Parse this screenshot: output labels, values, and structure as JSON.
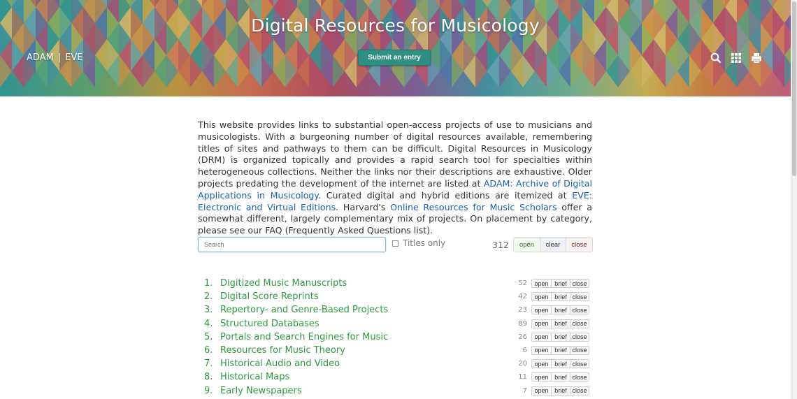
{
  "header": {
    "title": "Digital Resources for Musicology",
    "nav": [
      {
        "label": "ADAM"
      },
      {
        "label": "EVE"
      }
    ],
    "nav_separator": "|",
    "submit_label": "Submit an entry",
    "icons": [
      "search-icon",
      "grid-icon",
      "print-icon"
    ]
  },
  "intro": {
    "p1": "This website provides links to substantial open-access projects of use to musicians and musicologists. With a burgeoning number of digital resources available, remembering titles of sites and pathways to them can be difficult. Digital Resources in Musicology (DRM) is organized topically and provides a rapid search tool for specialties within heterogeneous collections. Neither the links nor their descriptions are exhaustive. Older projects predating the development of the internet are listed at ",
    "link_adam": "ADAM: Archive of Digital Applications in Musicology",
    "p2": ". Curated digital and hybrid editions are itemized at ",
    "link_eve": "EVE: Electronic and Virtual Editions",
    "p3": ". Harvard's ",
    "link_harvard": "Online Resources for Music Scholars",
    "p4": " offer a somewhat different, largely complementary mix of projects. On placement by category, please see our FAQ (Frequently Asked Questions list)."
  },
  "search": {
    "placeholder": "Search",
    "value": "",
    "titles_only_label": "Titles only",
    "total": "312",
    "open_label": "open",
    "clear_label": "clear",
    "close_label": "close"
  },
  "row_buttons": {
    "open": "open",
    "brief": "brief",
    "close": "close"
  },
  "categories": [
    {
      "num": "1.",
      "title": "Digitized Music Manuscripts",
      "count": "52"
    },
    {
      "num": "2.",
      "title": "Digital Score Reprints",
      "count": "42"
    },
    {
      "num": "3.",
      "title": "Repertory- and Genre-Based Projects",
      "count": "23"
    },
    {
      "num": "4.",
      "title": "Structured Databases",
      "count": "89"
    },
    {
      "num": "5.",
      "title": "Portals and Search Engines for Music",
      "count": "26"
    },
    {
      "num": "6.",
      "title": "Resources for Music Theory",
      "count": "6"
    },
    {
      "num": "7.",
      "title": "Historical Audio and Video",
      "count": "20"
    },
    {
      "num": "8.",
      "title": "Historical Maps",
      "count": "11"
    },
    {
      "num": "9.",
      "title": "Early Newspapers",
      "count": "7"
    }
  ],
  "colors": {
    "accent_green": "#2e9a3e",
    "link_blue": "#1b5fae",
    "submit_teal": "#2f8f83"
  }
}
